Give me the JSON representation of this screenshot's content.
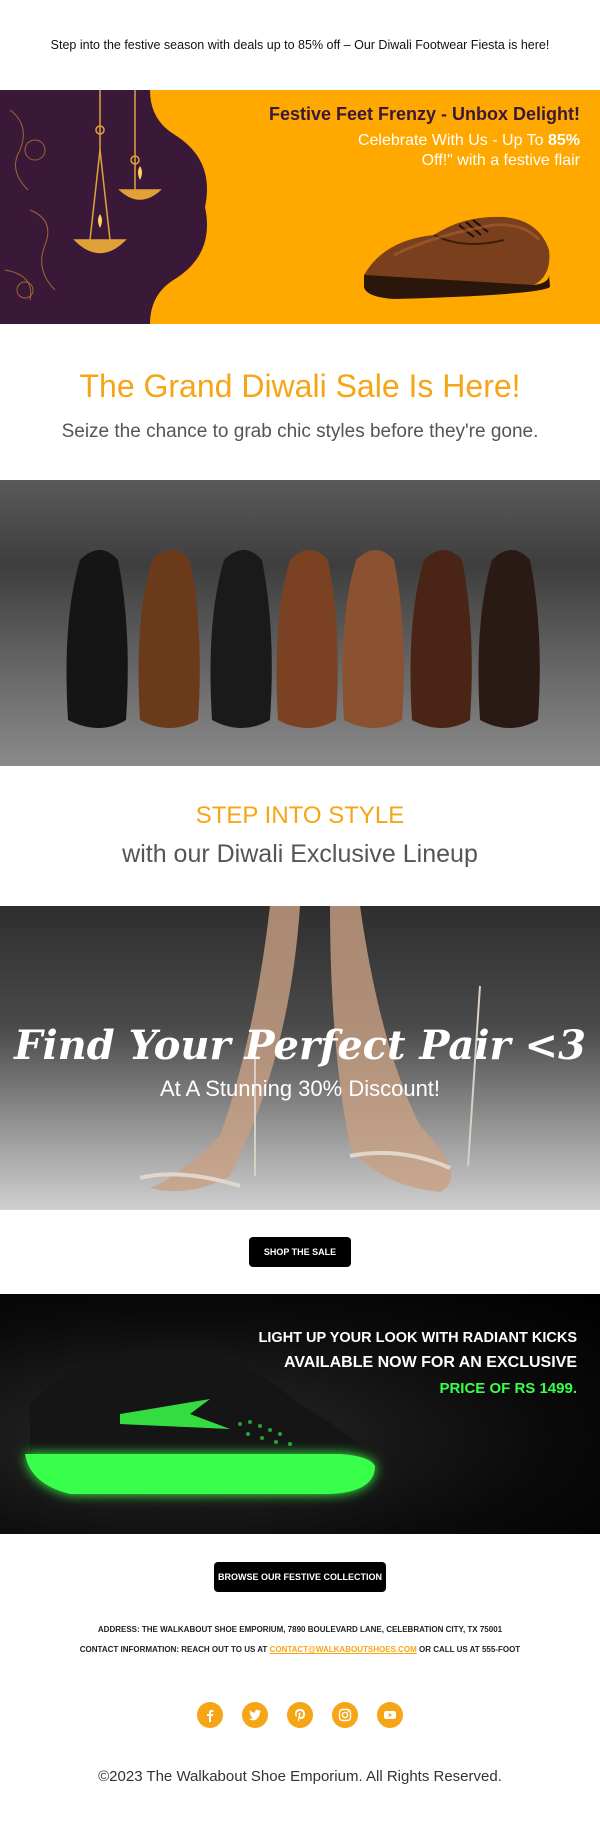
{
  "preheader": {
    "text": "Step into the festive season with deals up to 85% off – Our Diwali Footwear Fiesta is here!"
  },
  "hero": {
    "title": "Festive Feet Frenzy - Unbox Delight!",
    "line1": "Celebrate With Us - Up To",
    "line1_bold": "85%",
    "line2": "Off!\" with a festive flair",
    "colors": {
      "background": "#ffa800",
      "arch": "#3a1838"
    }
  },
  "sale": {
    "title": "The Grand Diwali Sale Is Here!",
    "subtitle": "Seize the chance to grab chic styles before they're gone."
  },
  "style": {
    "title": "STEP INTO STYLE",
    "subtitle": "with our Diwali Exclusive Lineup"
  },
  "heels": {
    "title": "Find Your Perfect Pair <3",
    "subtitle": "At A Stunning 30% Discount!"
  },
  "shop_button": {
    "label": "SHOP THE SALE"
  },
  "kicks": {
    "line1": "LIGHT UP YOUR LOOK WITH RADIANT KICKS",
    "line2": "AVAILABLE NOW FOR AN EXCLUSIVE",
    "line3": "PRICE OF RS 1499.",
    "colors": {
      "accent": "#39ff4a"
    }
  },
  "collection_button": {
    "label": "BROWSE OUR FESTIVE COLLECTION"
  },
  "footer": {
    "address": "ADDRESS: THE WALKABOUT SHOE EMPORIUM, 7890 BOULEVARD LANE, CELEBRATION CITY, TX 75001",
    "contact_prefix": "CONTACT INFORMATION: REACH OUT TO US AT",
    "contact_email": "CONTACT@WALKABOUTSHOES.COM",
    "contact_suffix": "OR CALL US AT 555-FOOT",
    "social": [
      "facebook-icon",
      "twitter-icon",
      "pinterest-icon",
      "instagram-icon",
      "youtube-icon"
    ],
    "copyright": "©2023 The Walkabout Shoe Emporium. All Rights Reserved."
  },
  "colors": {
    "accent": "#f5a516"
  }
}
